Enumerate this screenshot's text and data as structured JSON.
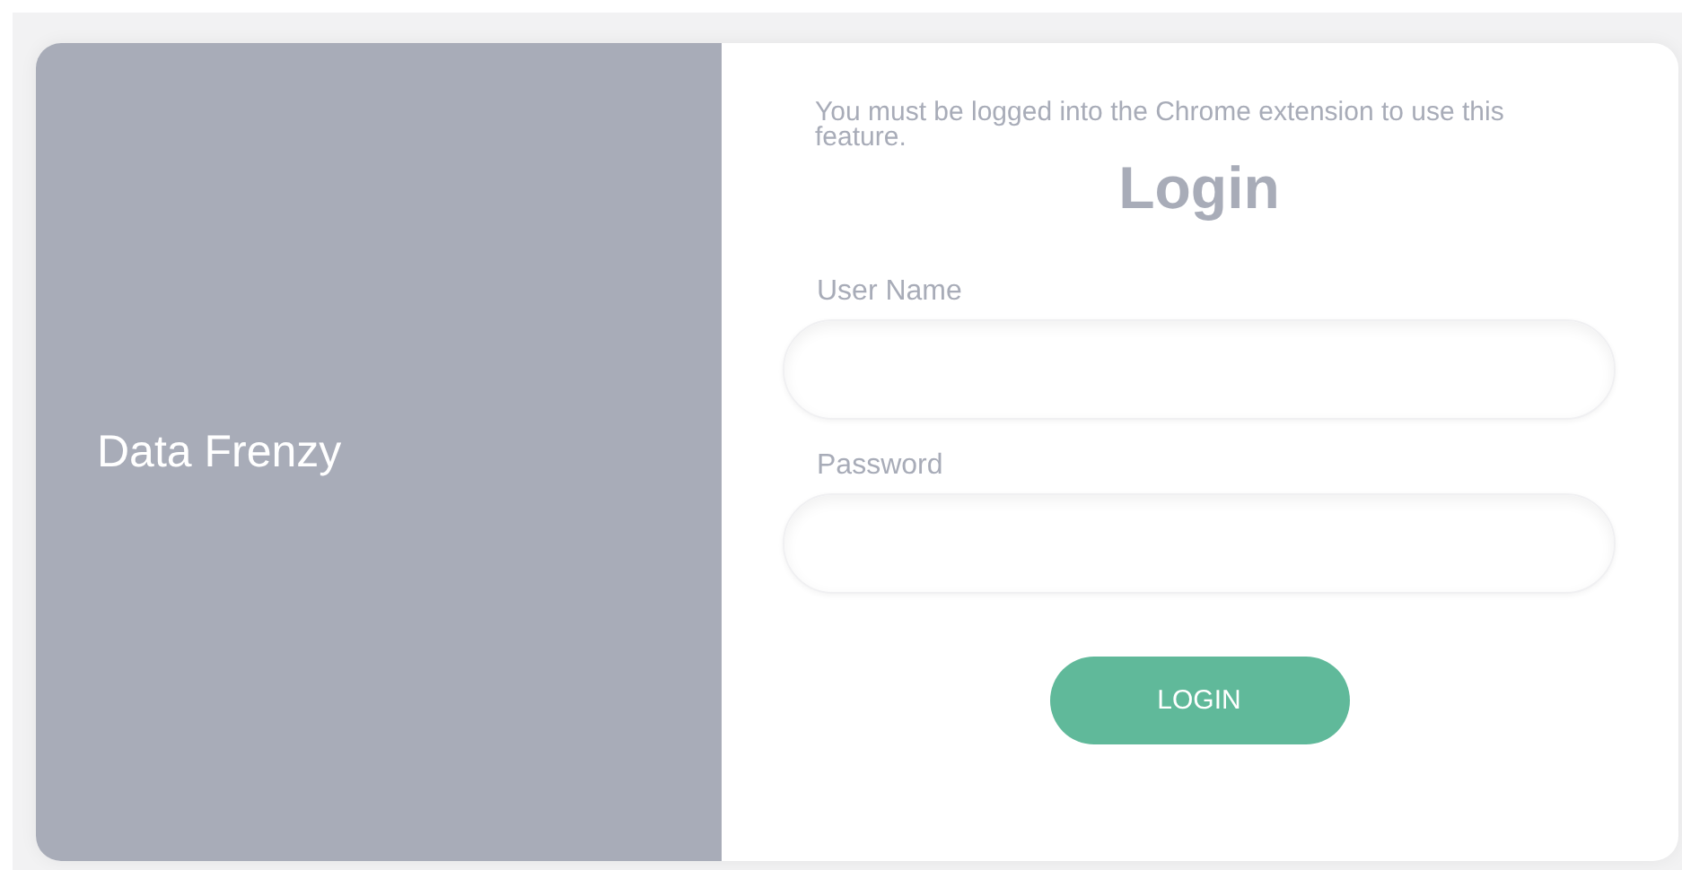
{
  "brand": "Data Frenzy",
  "notice": "You must be logged into the Chrome extension to use this feature.",
  "title": "Login",
  "fields": [
    {
      "label": "User Name"
    },
    {
      "label": "Password"
    }
  ],
  "button": "LOGIN"
}
